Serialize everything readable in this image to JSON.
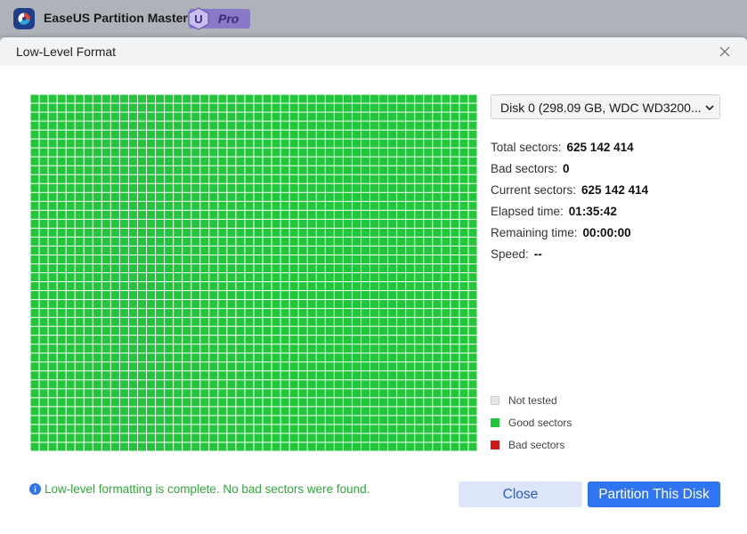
{
  "app": {
    "title": "EaseUS Partition Master",
    "badge_letter": "U",
    "badge_text": "Pro"
  },
  "dialog": {
    "title": "Low-Level Format"
  },
  "disk_select": {
    "selected": "Disk 0 (298.09 GB, WDC WD3200..."
  },
  "stats": [
    {
      "label": "Total sectors:",
      "value": "625 142 414"
    },
    {
      "label": "Bad sectors:",
      "value": "0"
    },
    {
      "label": "Current sectors:",
      "value": "625 142 414"
    },
    {
      "label": "Elapsed time:",
      "value": "01:35:42"
    },
    {
      "label": "Remaining time:",
      "value": "00:00:00"
    },
    {
      "label": "Speed:",
      "value": "--"
    }
  ],
  "legend": [
    {
      "label": "Not tested",
      "color": "#e6e6e6"
    },
    {
      "label": "Good sectors",
      "color": "#22c63a"
    },
    {
      "label": "Bad sectors",
      "color": "#d01818"
    }
  ],
  "grid": {
    "good_color": "#22c63a",
    "tested_fraction": 1.0,
    "bad_cells": 0
  },
  "status_message": "Low-level formatting is complete. No bad sectors were found.",
  "buttons": {
    "close": "Close",
    "partition": "Partition This Disk"
  },
  "colors": {
    "accent": "#2f74f0",
    "success": "#2fa83b"
  }
}
